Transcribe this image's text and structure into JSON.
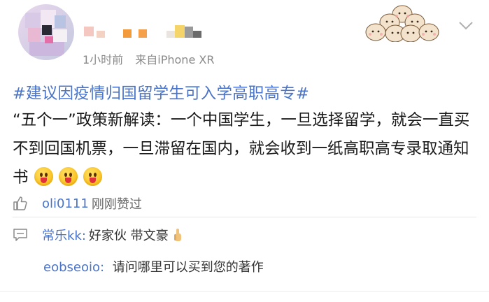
{
  "post": {
    "meta_time": "1小时前",
    "meta_source": "来自iPhone XR",
    "hashtag": "#建议因疫情归国留学生可入学高职高专#",
    "body_text": "“五个一”政策新解读：一个中国学生，一旦选择留学，就会一直买不到回国机票，一旦滞留在国内，就会收到一纸高职高专录取通知书",
    "emojis": [
      "tongue-out-emoji",
      "tongue-out-emoji",
      "tongue-out-emoji"
    ]
  },
  "likes": {
    "user": "oli0111",
    "text": "刚刚赞过"
  },
  "comments": [
    {
      "user": "常乐kk:",
      "text": "好家伙 带文豪"
    },
    {
      "user": "eobseoio:",
      "text": "请问哪里可以买到您的著作"
    }
  ],
  "icons": {
    "like": "thumbs-up-icon",
    "comment": "comment-icon",
    "menu": "chevron-down-icon"
  },
  "colors": {
    "link": "#4a74c9",
    "meta": "#8a8a8a"
  }
}
